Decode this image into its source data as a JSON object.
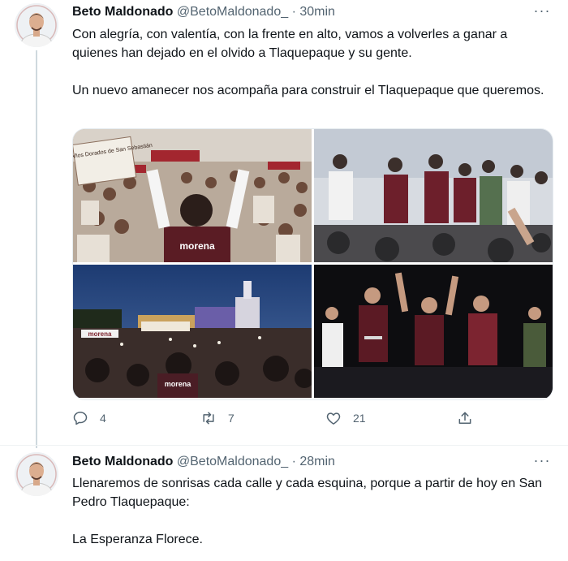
{
  "tweets": [
    {
      "author_name": "Beto Maldonado",
      "handle": "@BetoMaldonado_",
      "time": "· 30min",
      "text": "Con alegría, con valentía, con la frente en alto, vamos a volverles a ganar a quienes han dejado en el olvido a Tlaquepaque y su gente.\n\nUn nuevo amanecer nos acompaña para construir el Tlaquepaque que queremos.",
      "more_label": "···",
      "photos": [
        {
          "icon": "rally-crowd-photo",
          "sign_text": "Grupo Años Dorados de San Sebastián",
          "shirt_text": "morena"
        },
        {
          "icon": "stage-leaders-photo"
        },
        {
          "icon": "night-plaza-crowd-photo",
          "banner_text": "morena",
          "shirt_text": "morena"
        },
        {
          "icon": "night-stage-photo"
        }
      ],
      "actions": {
        "reply_count": "4",
        "retweet_count": "7",
        "like_count": "21"
      }
    },
    {
      "author_name": "Beto Maldonado",
      "handle": "@BetoMaldonado_",
      "time": "· 28min",
      "text": "Llenaremos de sonrisas cada calle y cada esquina, porque a partir de hoy en San Pedro Tlaquepaque:\n\nLa Esperanza Florece.",
      "more_label": "···"
    }
  ],
  "colors": {
    "text": "#0f1419",
    "secondary": "#536471",
    "thread_line": "#cfd9de",
    "brand_maroon": "#7b1f2a"
  }
}
